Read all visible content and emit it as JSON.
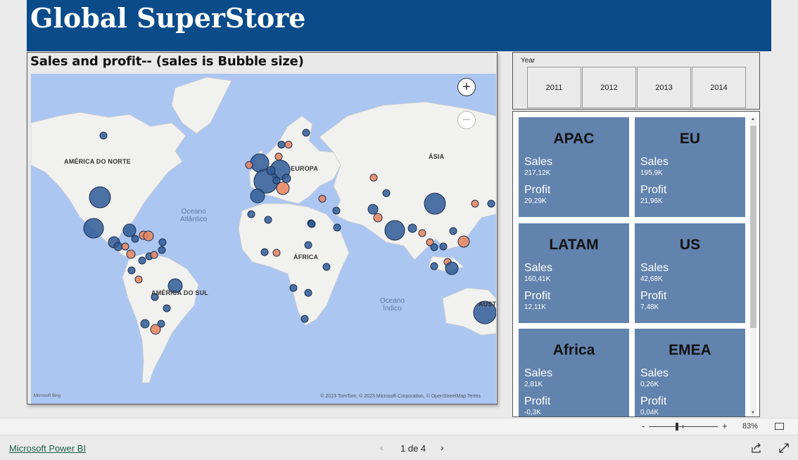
{
  "header": {
    "title": "Global SuperStore"
  },
  "map": {
    "title": "Sales and profit-- (sales is Bubble size)",
    "continent_labels": [
      "AMÉRICA DO NORTE",
      "EUROPA",
      "ÁSIA",
      "ÁFRICA",
      "AMÉRICA DO SUL",
      "AUSTR"
    ],
    "ocean_labels": [
      {
        "line1": "Oceano",
        "line2": "Atlântico"
      },
      {
        "line1": "Oceano",
        "line2": "Índico"
      }
    ],
    "logo_text": "Microsoft Bing",
    "copyright": "© 2023 TomTom, © 2023 Microsoft Corporation, © OpenStreetMap  Terms",
    "colors": {
      "positive_profit": "#2f5b97",
      "negative_profit": "#e7825d",
      "water": "#abc6f1",
      "land": "#f1f1ef"
    }
  },
  "slicer": {
    "label": "Year",
    "years": [
      "2011",
      "2012",
      "2013",
      "2014"
    ]
  },
  "regions": [
    {
      "name": "APAC",
      "sales_label": "Sales",
      "sales": "217,12K",
      "profit_label": "Profit",
      "profit": "29,29K"
    },
    {
      "name": "EU",
      "sales_label": "Sales",
      "sales": "195,9K",
      "profit_label": "Profit",
      "profit": "21,96K"
    },
    {
      "name": "LATAM",
      "sales_label": "Sales",
      "sales": "160,41K",
      "profit_label": "Profit",
      "profit": "12,11K"
    },
    {
      "name": "US",
      "sales_label": "Sales",
      "sales": "42,68K",
      "profit_label": "Profit",
      "profit": "7,48K"
    },
    {
      "name": "Africa",
      "sales_label": "Sales",
      "sales": "2,81K",
      "profit_label": "Profit",
      "profit": "-0,3K"
    },
    {
      "name": "EMEA",
      "sales_label": "Sales",
      "sales": "0,26K",
      "profit_label": "Profit",
      "profit": "0,04K"
    }
  ],
  "zoom": {
    "minus": "-",
    "plus": "+",
    "percent": "83%"
  },
  "footer": {
    "brand_link": "Microsoft Power BI",
    "page_indicator": "1 de 4",
    "prev": "‹",
    "next": "›"
  }
}
